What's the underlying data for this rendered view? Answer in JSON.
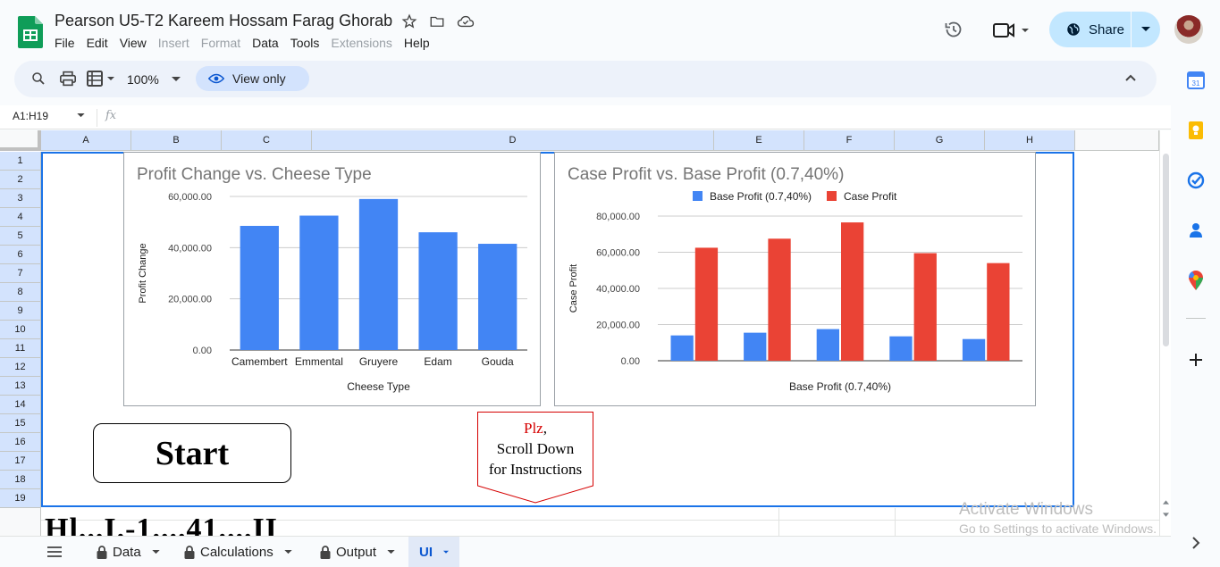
{
  "doc": {
    "title": "Pearson U5-T2 Kareem Hossam Farag Ghorab",
    "menu": [
      "File",
      "Edit",
      "View",
      "Insert",
      "Format",
      "Data",
      "Tools",
      "Extensions",
      "Help"
    ],
    "menu_disabled": [
      "Insert",
      "Format",
      "Extensions"
    ]
  },
  "header": {
    "share_label": "Share"
  },
  "toolbar": {
    "zoom": "100%",
    "view_only_label": "View only"
  },
  "formula_bar": {
    "name_box": "A1:H19",
    "fx_label": "fx"
  },
  "columns": [
    "A",
    "B",
    "C",
    "D",
    "E",
    "F",
    "G",
    "H"
  ],
  "rows": [
    "1",
    "2",
    "3",
    "4",
    "5",
    "6",
    "7",
    "8",
    "9",
    "10",
    "11",
    "12",
    "13",
    "14",
    "15",
    "16",
    "17",
    "18",
    "19"
  ],
  "chart_data": [
    {
      "type": "bar",
      "title": "Profit Change vs. Cheese Type",
      "xlabel": "Cheese Type",
      "ylabel": "Profit Change",
      "categories": [
        "Camembert",
        "Emmental",
        "Gruyere",
        "Edam",
        "Gouda"
      ],
      "values": [
        48500,
        52500,
        59000,
        46000,
        41500
      ],
      "yticks": [
        "0.00",
        "20,000.00",
        "40,000.00",
        "60,000.00"
      ],
      "ylim": [
        0,
        60000
      ],
      "color": "#4285f4",
      "grid": true,
      "legend": "none"
    },
    {
      "type": "bar",
      "title": "Case Profit vs. Base Profit (0.7,40%)",
      "xlabel": "Base Profit (0.7,40%)",
      "ylabel": "Case Profit",
      "categories": [
        "",
        "",
        "",
        "",
        ""
      ],
      "series": [
        {
          "name": "Base Profit (0.7,40%)",
          "values": [
            14000,
            15500,
            17500,
            13500,
            12000
          ],
          "color": "#4285f4"
        },
        {
          "name": "Case Profit",
          "values": [
            62500,
            67500,
            76500,
            59500,
            54000
          ],
          "color": "#ea4335"
        }
      ],
      "yticks": [
        "0.00",
        "20,000.00",
        "40,000.00",
        "60,000.00",
        "80,000.00"
      ],
      "ylim": [
        0,
        80000
      ],
      "grid": true,
      "legend": "top"
    }
  ],
  "sheet": {
    "start_label": "Start",
    "plz_red": "Plz",
    "plz_comma": ",",
    "plz_line2": "Scroll Down",
    "plz_line3": "for Instructions",
    "peek_text": "Hl...I.-1....41....II"
  },
  "tabs": [
    {
      "label": "Data",
      "locked": true
    },
    {
      "label": "Calculations",
      "locked": true
    },
    {
      "label": "Output",
      "locked": true
    },
    {
      "label": "UI",
      "locked": false,
      "active": true
    }
  ],
  "watermark": {
    "line1": "Activate Windows",
    "line2": "Go to Settings to activate Windows."
  },
  "colors": {
    "accent": "#1a73e8",
    "share_bg": "#c2e7ff",
    "selection_header": "#d3e3fd"
  }
}
